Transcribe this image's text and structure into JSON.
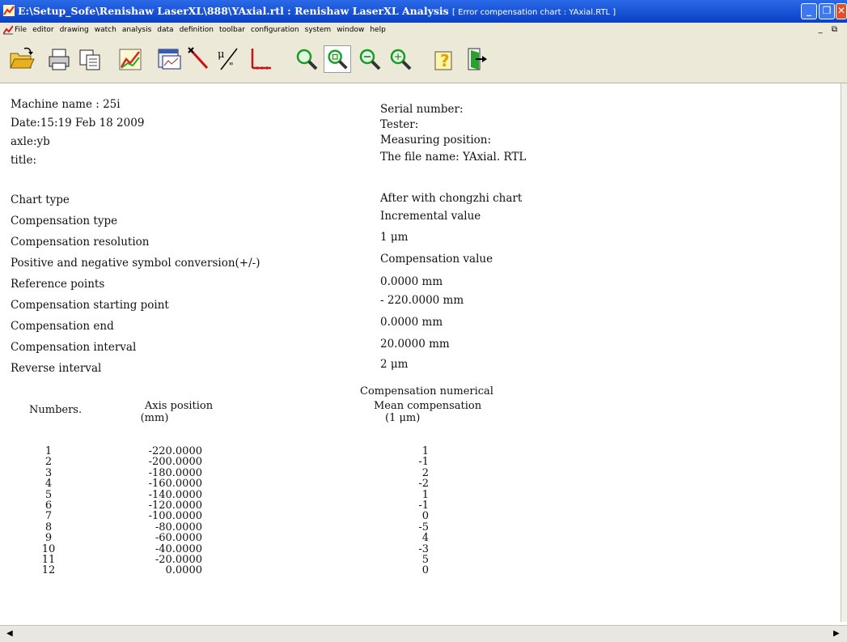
{
  "window": {
    "title_main": "E:\\Setup_Sofe\\Renishaw LaserXL\\888\\YAxial.rtl : Renishaw LaserXL Analysis",
    "title_sub": "[ Error compensation chart : YAxial.RTL ]"
  },
  "menu": [
    "File",
    "editor",
    "drawing",
    "watch",
    "analysis",
    "data",
    "definition",
    "toolbar",
    "configuration",
    "system",
    "window",
    "help"
  ],
  "mdi_controls": "_ ⧉",
  "toolbar_icons": [
    "open-icon",
    "print-icon",
    "copy-icon",
    "chart-icon",
    "report-icon",
    "pointer-tool-icon",
    "fraction-icon",
    "axis-icon",
    "zoom-icon",
    "zoom-box-icon",
    "zoom-out-icon",
    "zoom-fit-icon",
    "help-icon",
    "exit-icon"
  ],
  "info": {
    "machine_name": "Machine name : 25i",
    "date": "Date:15:19 Feb 18 2009",
    "axle": "axle:yb",
    "title": "title:",
    "serial_number": "Serial number:",
    "tester": "Tester:",
    "measuring_position": "Measuring position:",
    "file_name": "The file name: YAxial. RTL"
  },
  "settings": [
    {
      "label": "Chart type",
      "value": "After with chongzhi chart"
    },
    {
      "label": "Compensation type",
      "value": "Incremental value"
    },
    {
      "label": "Compensation resolution",
      "value": "1 μm"
    },
    {
      "label": "Positive and negative symbol conversion(+/-)",
      "value": "Compensation value"
    },
    {
      "label": "Reference points",
      "value": "0.0000 mm"
    },
    {
      "label": "Compensation starting point",
      "value": "- 220.0000 mm"
    },
    {
      "label": "Compensation end",
      "value": "0.0000 mm"
    },
    {
      "label": "Compensation interval",
      "value": "20.0000 mm"
    },
    {
      "label": "Reverse interval",
      "value": "2 μm"
    }
  ],
  "table": {
    "section_title": "Compensation numerical",
    "col_numbers": "Numbers.",
    "col_axis": "Axis position",
    "col_axis_unit": "(mm)",
    "col_mean": "Mean compensation",
    "col_mean_unit": "(1 μm)",
    "rows": [
      {
        "n": "1",
        "pos": "-220.0000",
        "comp": "1"
      },
      {
        "n": "2",
        "pos": "-200.0000",
        "comp": "-1"
      },
      {
        "n": "3",
        "pos": "-180.0000",
        "comp": "2"
      },
      {
        "n": "4",
        "pos": "-160.0000",
        "comp": "-2"
      },
      {
        "n": "5",
        "pos": "-140.0000",
        "comp": "1"
      },
      {
        "n": "6",
        "pos": "-120.0000",
        "comp": "-1"
      },
      {
        "n": "7",
        "pos": "-100.0000",
        "comp": "0"
      },
      {
        "n": "8",
        "pos": "-80.0000",
        "comp": "-5"
      },
      {
        "n": "9",
        "pos": "-60.0000",
        "comp": "4"
      },
      {
        "n": "10",
        "pos": "-40.0000",
        "comp": "-3"
      },
      {
        "n": "11",
        "pos": "-20.0000",
        "comp": "5"
      },
      {
        "n": "12",
        "pos": "0.0000",
        "comp": "0"
      }
    ]
  }
}
